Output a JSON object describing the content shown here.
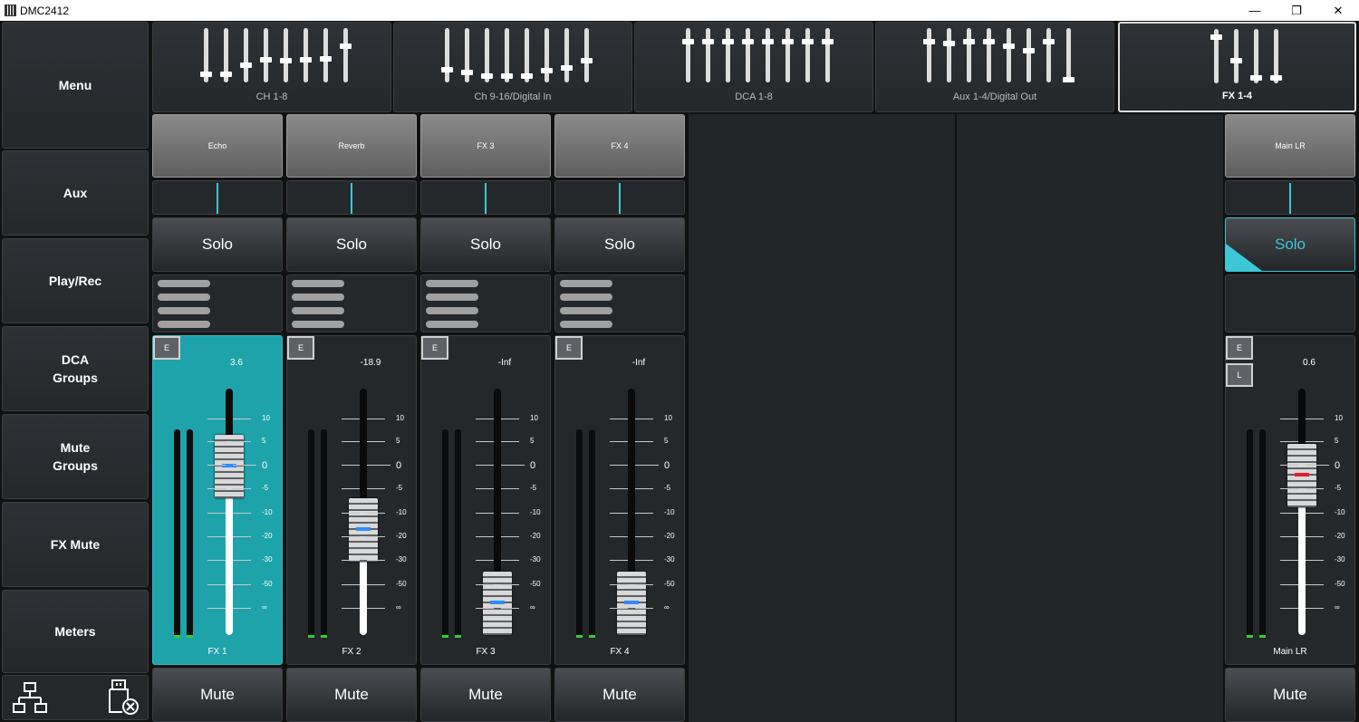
{
  "window": {
    "title": "DMC2412",
    "minimize_glyph": "—",
    "maximize_glyph": "❐",
    "close_glyph": "✕"
  },
  "sidebar": {
    "items": [
      {
        "label": "Menu"
      },
      {
        "label": "Aux"
      },
      {
        "label": "Play/Rec"
      },
      {
        "label": "DCA\nGroups"
      },
      {
        "label": "Mute\nGroups"
      },
      {
        "label": "FX Mute"
      },
      {
        "label": "Meters"
      }
    ],
    "bottom_icons": [
      "network-icon",
      "usb-disconnected-icon"
    ]
  },
  "layers": [
    {
      "label": "CH 1-8",
      "levels": [
        0.12,
        0.12,
        0.3,
        0.4,
        0.38,
        0.4,
        0.42,
        0.68
      ],
      "active": false
    },
    {
      "label": "Ch 9-16/Digital In",
      "levels": [
        0.2,
        0.15,
        0.08,
        0.08,
        0.08,
        0.18,
        0.25,
        0.38
      ],
      "active": false
    },
    {
      "label": "DCA 1-8",
      "levels": [
        0.78,
        0.78,
        0.78,
        0.78,
        0.78,
        0.78,
        0.78,
        0.78
      ],
      "active": false
    },
    {
      "label": "Aux 1-4/Digital Out",
      "levels": [
        0.78,
        0.75,
        0.78,
        0.78,
        0.68,
        0.6,
        0.78,
        0.0
      ],
      "active": false
    },
    {
      "label": "FX 1-4",
      "levels": [
        0.88,
        0.4,
        0.05,
        0.05
      ],
      "active": true
    }
  ],
  "scale": [
    "10",
    "5",
    "0",
    "-5",
    "-10",
    "-20",
    "-30",
    "-50",
    "∞"
  ],
  "strips": [
    {
      "name": "Echo",
      "solo": "Solo",
      "edit": "E",
      "value": "3.6",
      "label": "FX 1",
      "mute": "Mute",
      "fader_level": 0.75,
      "selected": true
    },
    {
      "name": "Reverb",
      "solo": "Solo",
      "edit": "E",
      "value": "-18.9",
      "label": "FX 2",
      "mute": "Mute",
      "fader_level": 0.4,
      "selected": false
    },
    {
      "name": "FX 3",
      "solo": "Solo",
      "edit": "E",
      "value": "-Inf",
      "label": "FX 3",
      "mute": "Mute",
      "fader_level": 0.0,
      "selected": false
    },
    {
      "name": "FX 4",
      "solo": "Solo",
      "edit": "E",
      "value": "-Inf",
      "label": "FX 4",
      "mute": "Mute",
      "fader_level": 0.0,
      "selected": false
    }
  ],
  "main": {
    "name": "Main LR",
    "solo": "Solo",
    "edit": "E",
    "link": "L",
    "value": "0.6",
    "label": "Main LR",
    "mute": "Mute",
    "fader_level": 0.7
  },
  "colors": {
    "accent": "#3cc7d6",
    "selected_strip": "#1fa3ab",
    "meter_green": "#33cc33"
  }
}
